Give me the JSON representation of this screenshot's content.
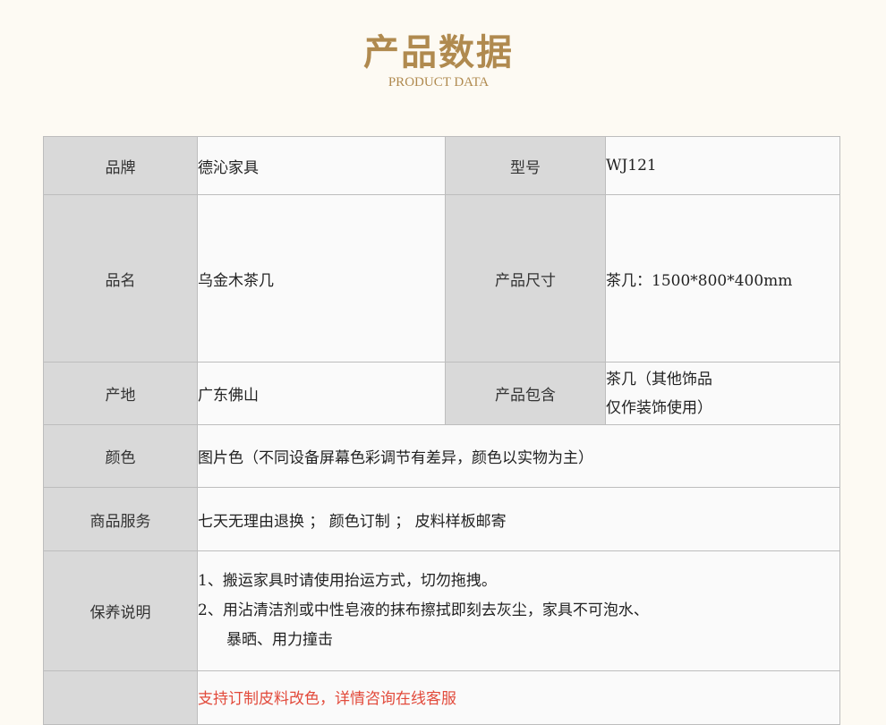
{
  "header": {
    "title": "产品数据",
    "subtitle": "PRODUCT DATA"
  },
  "rows": {
    "brand_label": "品牌",
    "brand_value": "德沁家具",
    "model_label": "型号",
    "model_value": "WJ121",
    "name_label": "品名",
    "name_value": "乌金木茶几",
    "size_label": "产品尺寸",
    "size_value": "茶几：1500*800*400mm",
    "origin_label": "产地",
    "origin_value": "广东佛山",
    "includes_label": "产品包含",
    "includes_line1": "茶几（其他饰品",
    "includes_line2": "仅作装饰使用）",
    "color_label": "颜色",
    "color_value": "图片色（不同设备屏幕色彩调节有差异，颜色以实物为主）",
    "service_label": "商品服务",
    "service_value": "七天无理由退换 ； 颜色订制 ； 皮料样板邮寄",
    "care_label": "保养说明",
    "care_line1": "1、搬运家具时请使用抬运方式，切勿拖拽。",
    "care_line2": "2、用沾清洁剂或中性皂液的抹布擦拭即刻去灰尘，家具不可泡水、",
    "care_line3": "暴晒、用力撞击",
    "custom_value": "支持订制皮料改色，详情咨询在线客服"
  },
  "colors": {
    "title": "#b08a4f",
    "label_bg": "#d9d9d9",
    "value_bg": "#fafafa",
    "page_bg": "#fdfaf3",
    "highlight": "#e24a3b"
  }
}
